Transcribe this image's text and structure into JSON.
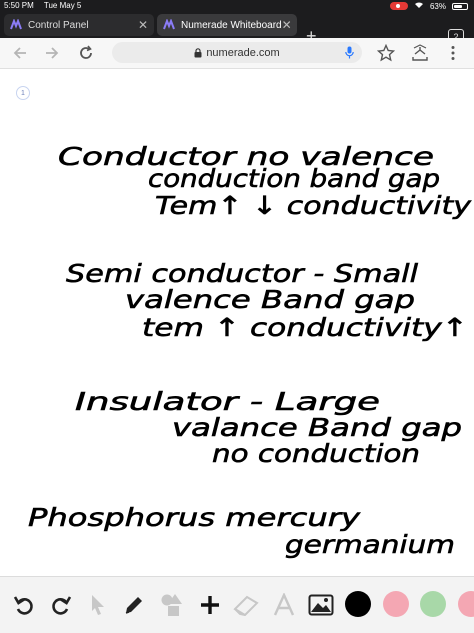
{
  "status_bar": {
    "time": "5:50 PM",
    "date": "Tue May 5",
    "battery": "63%"
  },
  "tabs": [
    {
      "label": "Control Panel",
      "active": false
    },
    {
      "label": "Numerade Whiteboard",
      "active": true
    }
  ],
  "tab_count": "2",
  "address_bar": {
    "url": "numerade.com"
  },
  "whiteboard": {
    "page_number": "1",
    "notes": [
      "Conductor  no valence",
      "conduction band gap",
      "Tem↑   ↓ conductivity",
      "Semi conductor - Small",
      "valence Band gap",
      "tem ↑ conductivity↑",
      "Insulator - Large",
      "valance Band gap",
      "no conduction",
      "Phosphorus   mercury",
      "germanium"
    ]
  },
  "toolbar": {
    "tools": [
      "undo-icon",
      "redo-icon",
      "pointer-icon",
      "pen-icon",
      "shapes-icon",
      "add-icon",
      "eraser-icon",
      "text-icon",
      "image-icon"
    ],
    "colors": [
      "#000000",
      "#f4a7b3",
      "#a8d8a8",
      "#f4a7b3"
    ]
  }
}
